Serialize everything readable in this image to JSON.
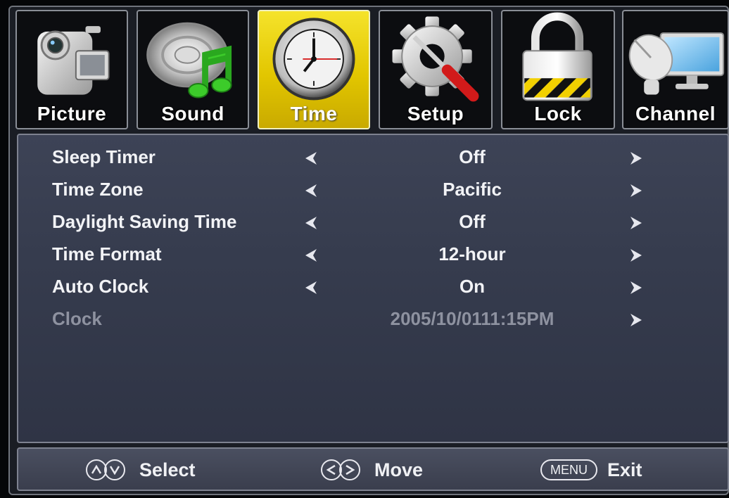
{
  "tabs": [
    {
      "label": "Picture",
      "icon": "camcorder-icon",
      "active": false
    },
    {
      "label": "Sound",
      "icon": "speaker-music-note-icon",
      "active": false
    },
    {
      "label": "Time",
      "icon": "clock-icon",
      "active": true
    },
    {
      "label": "Setup",
      "icon": "gear-screwdriver-icon",
      "active": false
    },
    {
      "label": "Lock",
      "icon": "padlock-icon",
      "active": false
    },
    {
      "label": "Channel",
      "icon": "satellite-monitor-icon",
      "active": false
    }
  ],
  "menu": {
    "rows": [
      {
        "name": "Sleep Timer",
        "value": "Off",
        "enabled": true
      },
      {
        "name": "Time Zone",
        "value": "Pacific",
        "enabled": true
      },
      {
        "name": "Daylight Saving Time",
        "value": "Off",
        "enabled": true
      },
      {
        "name": "Time Format",
        "value": "12-hour",
        "enabled": true
      },
      {
        "name": "Auto Clock",
        "value": "On",
        "enabled": true
      },
      {
        "name": "Clock",
        "value": "2005/10/0111:15PM",
        "enabled": false
      }
    ]
  },
  "footer": {
    "select_label": "Select",
    "move_label": "Move",
    "menu_key": "MENU",
    "exit_label": "Exit"
  },
  "colors": {
    "active_tab": "#e2c600",
    "panel": "#363c4e",
    "text": "#f2f3f6",
    "disabled_text": "#8e92a0"
  }
}
